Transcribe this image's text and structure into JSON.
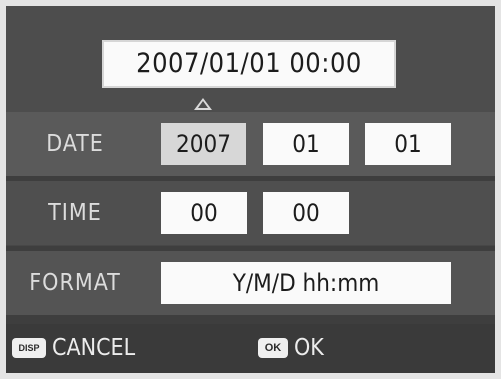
{
  "preview": {
    "datetime": "2007/01/01 00:00"
  },
  "date": {
    "label": "DATE",
    "year": "2007",
    "month": "01",
    "day": "01"
  },
  "time": {
    "label": "TIME",
    "hour": "00",
    "minute": "00"
  },
  "format": {
    "label": "FORMAT",
    "value": "Y/M/D hh:mm"
  },
  "footer": {
    "cancel_key": "DISP",
    "cancel_label": "CANCEL",
    "ok_key": "OK",
    "ok_label": "OK"
  },
  "icons": {
    "selection_caret": "caret-up-icon"
  },
  "colors": {
    "background": "#474747",
    "field": "#fafafa",
    "selected_field": "#d7d7d7",
    "text": "#1c1c1c"
  }
}
